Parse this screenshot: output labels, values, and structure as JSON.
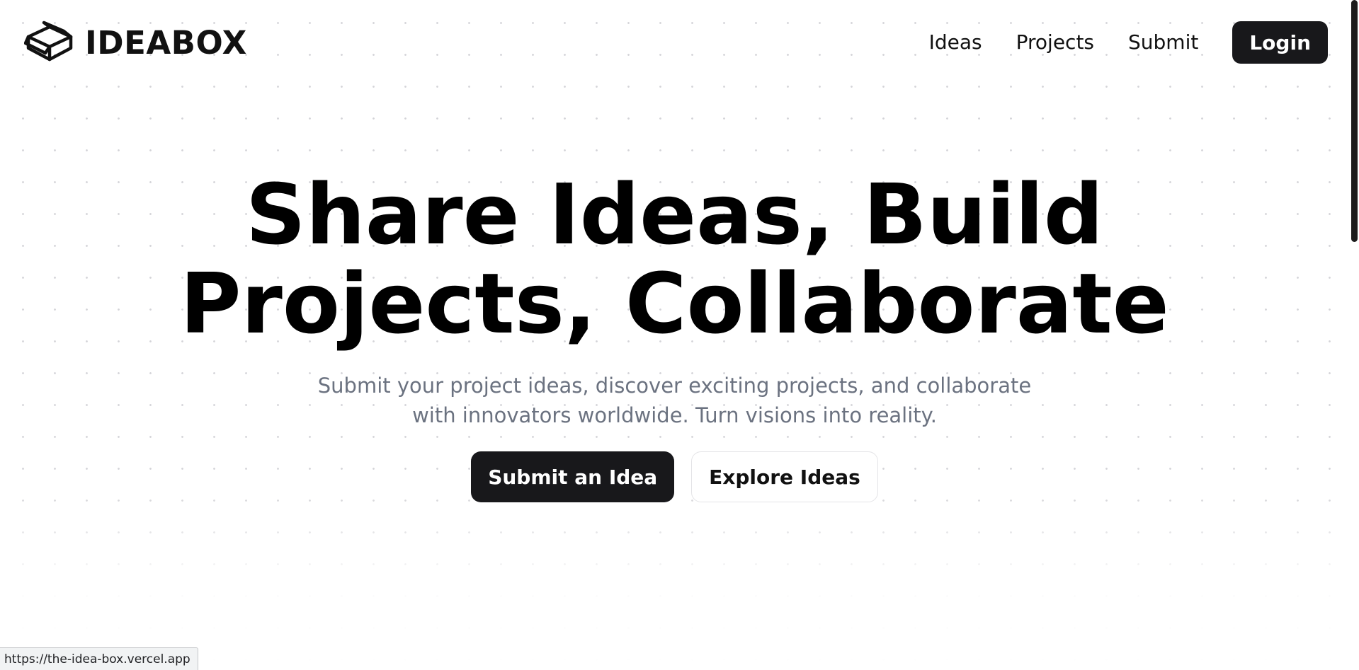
{
  "header": {
    "brand": "IDEABOX",
    "logo_icon": "open-box-icon",
    "nav": [
      {
        "label": "Ideas"
      },
      {
        "label": "Projects"
      },
      {
        "label": "Submit"
      }
    ],
    "login_label": "Login"
  },
  "hero": {
    "title_line1": "Share Ideas, Build",
    "title_line2": "Projects, Collaborate",
    "subtitle_line1": "Submit your project ideas, discover exciting projects, and collaborate",
    "subtitle_line2": "with innovators worldwide. Turn visions into reality.",
    "primary_button": "Submit an Idea",
    "secondary_button": "Explore Ideas"
  },
  "status_bar": {
    "url": "https://the-idea-box.vercel.app"
  },
  "colors": {
    "primary": "#18181b",
    "muted_text": "#6b7280",
    "background": "#ffffff",
    "dot_grid": "#d4d4d8"
  }
}
